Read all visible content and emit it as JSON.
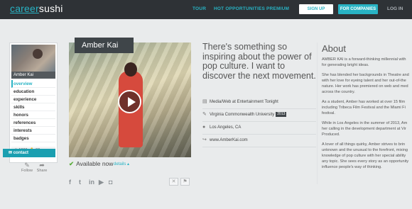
{
  "header": {
    "logo_left": "career",
    "logo_right": "sushi",
    "nav": [
      "TOUR",
      "HOT OPPORTUNITIES",
      "PREMIUM"
    ],
    "signup_label": "SIGN UP",
    "companies_label": "FOR COMPANIES",
    "login_label": "LOG IN"
  },
  "profile": {
    "name": "Amber Kai",
    "avatar_name": "Amber Kai",
    "menu": [
      "overview",
      "education",
      "experience",
      "skills",
      "honors",
      "references",
      "interests",
      "badges"
    ],
    "stats_views": "1096",
    "stats_likes": "60",
    "contact_label": "contact",
    "follow_label": "Follow",
    "share_label": "Share"
  },
  "video": {
    "available_label": "Available now",
    "details_label": "details"
  },
  "middle": {
    "headline": "There's something so inspiring about the power of pop culture. I want to discover the next movement.",
    "rows": [
      {
        "icon": "briefcase-icon",
        "glyph": "▤",
        "text": "Media/Web at Entertainment Tonight"
      },
      {
        "icon": "education-icon",
        "glyph": "✎",
        "text": "Virginia Commonwealth University",
        "badge": "2013"
      },
      {
        "icon": "location-icon",
        "glyph": "●",
        "text": "Los Angeles, CA"
      },
      {
        "icon": "link-icon",
        "glyph": "↪",
        "text": "www.AmberKai.com"
      }
    ]
  },
  "about": {
    "title": "About",
    "paragraphs": [
      "AMBER KAI is a forward-thinking millennial with",
      "for generating bright ideas.",
      "She has blended her backgrounds in Theatre and",
      "with her love for eyeing talent and her out-of-the",
      "nature. Her work has premiered on web and med",
      "across the country.",
      "As a student, Amber has worked at over 15 film",
      "including Tribeca Film Festival and the Miami Fi",
      "festival.",
      "While in Los Angeles in the summer of 2013, Am",
      "her calling in the development department at Vir",
      "Produced.",
      "A lover of all things quirky, Amber strives to brin",
      "unknown and the unusual to the forefront, mixing",
      "knowledge of pop culture with her special ability",
      "any topic. She sees every story as an opportunity",
      "influence people's way of thinking."
    ]
  },
  "colors": {
    "accent": "#28b3c4",
    "topbar": "#2e3236"
  }
}
